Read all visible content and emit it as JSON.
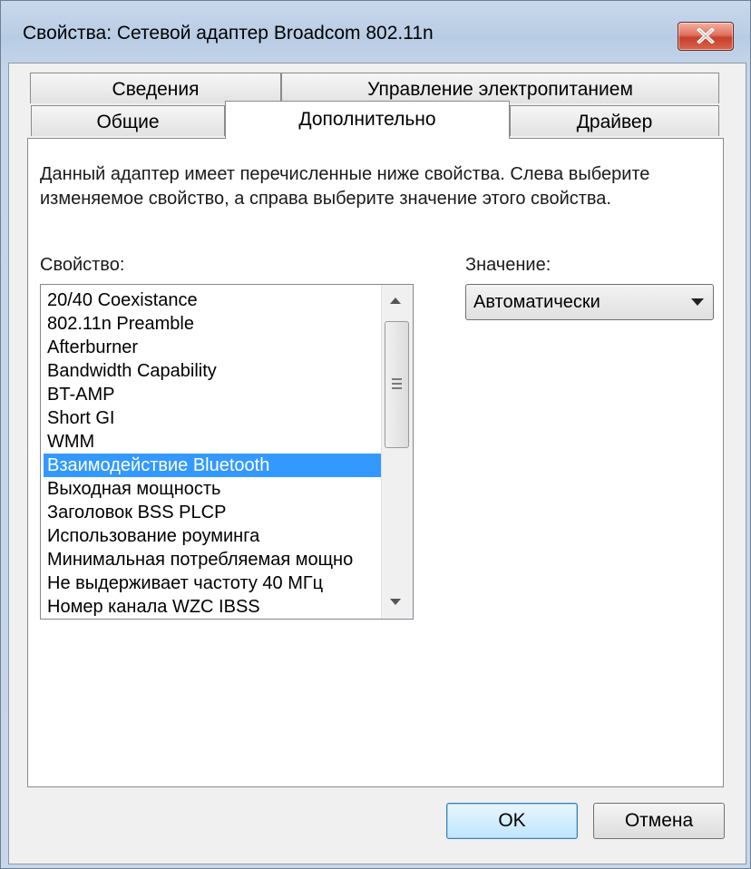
{
  "window": {
    "title": "Свойства: Сетевой адаптер Broadcom 802.11n"
  },
  "tabs": {
    "row_back": [
      {
        "label": "Сведения"
      },
      {
        "label": "Управление электропитанием"
      }
    ],
    "row_front": [
      {
        "label": "Общие"
      },
      {
        "label": "Дополнительно"
      },
      {
        "label": "Драйвер"
      }
    ],
    "active": "Дополнительно"
  },
  "advanced": {
    "description": "Данный адаптер имеет перечисленные ниже свойства. Слева выберите изменяемое свойство, а справа выберите значение этого свойства.",
    "property_label": "Свойство:",
    "value_label": "Значение:",
    "value_selected": "Автоматически",
    "properties": [
      "20/40 Coexistance",
      "802.11n Preamble",
      "Afterburner",
      "Bandwidth Capability",
      "BT-AMP",
      "Short GI",
      "WMM",
      "Взаимодействие Bluetooth",
      "Выходная мощность",
      "Заголовок BSS PLCP",
      "Использование роуминга",
      "Минимальная потребляемая мощно",
      "Не выдерживает частоту 40 МГц",
      "Номер канала WZC IBSS"
    ],
    "selected_property": "Взаимодействие Bluetooth"
  },
  "buttons": {
    "ok": "OK",
    "cancel": "Отмена"
  },
  "colors": {
    "selection": "#3399ff",
    "close_button": "#c6402b"
  }
}
